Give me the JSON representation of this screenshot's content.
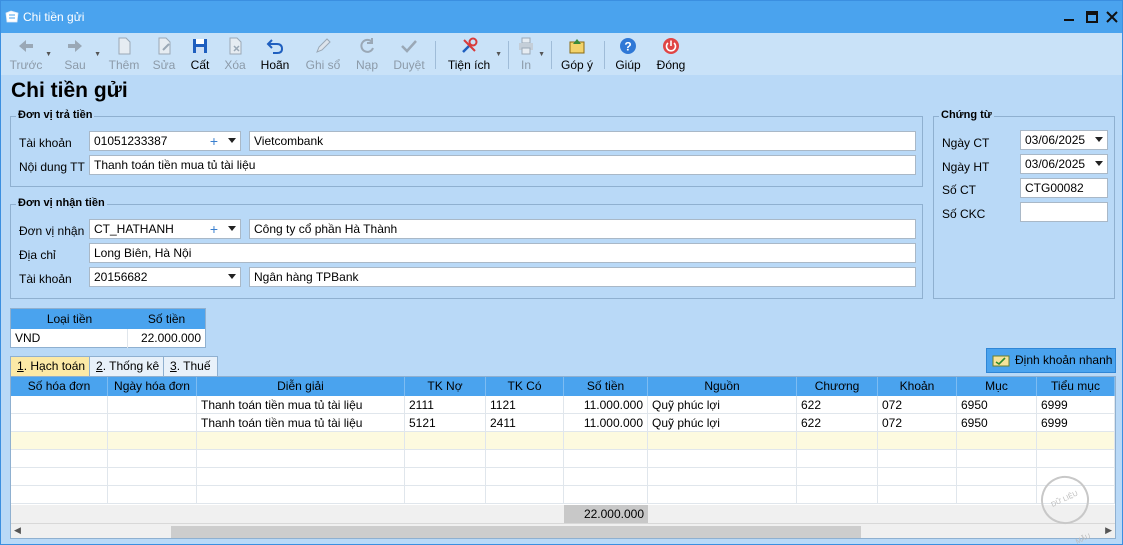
{
  "window": {
    "title": "Chi tiền gửi"
  },
  "toolbar": {
    "items": [
      {
        "label": "Trước",
        "icon": "arrow-left-icon"
      },
      {
        "label": "Sau",
        "icon": "arrow-right-icon"
      },
      {
        "label": "Thêm",
        "icon": "new-document-icon"
      },
      {
        "label": "Sửa",
        "icon": "edit-document-icon"
      },
      {
        "label": "Cất",
        "icon": "save-icon"
      },
      {
        "label": "Xóa",
        "icon": "delete-document-icon"
      },
      {
        "label": "Hoãn",
        "icon": "undo-icon"
      },
      {
        "label": "Ghi sổ",
        "icon": "pencil-icon"
      },
      {
        "label": "Nạp",
        "icon": "refresh-icon"
      },
      {
        "label": "Duyệt",
        "icon": "check-icon"
      },
      {
        "label": "Tiện ích",
        "icon": "tools-icon"
      },
      {
        "label": "In",
        "icon": "printer-icon"
      },
      {
        "label": "Góp ý",
        "icon": "feedback-icon"
      },
      {
        "label": "Giúp",
        "icon": "help-icon"
      },
      {
        "label": "Đóng",
        "icon": "power-icon"
      }
    ]
  },
  "page_title": "Chi tiền gửi",
  "payer": {
    "group_title": "Đơn vị trả tiền",
    "account_label": "Tài khoản",
    "account_value": "01051233387",
    "bank_name": "Vietcombank",
    "content_label": "Nội dung TT",
    "content_value": "Thanh toán tiền mua tủ tài liệu"
  },
  "payee": {
    "group_title": "Đơn vị nhận tiền",
    "unit_label": "Đơn vị nhận",
    "unit_code": "CT_HATHANH",
    "unit_name": "Công ty cổ phần Hà Thành",
    "address_label": "Địa chỉ",
    "address_value": "Long Biên, Hà Nội",
    "account_label": "Tài khoản",
    "account_value": "20156682",
    "bank_name": "Ngân hàng TPBank"
  },
  "voucher": {
    "group_title": "Chứng từ",
    "date_ct_label": "Ngày CT",
    "date_ct_value": "03/06/2025",
    "date_ht_label": "Ngày HT",
    "date_ht_value": "03/06/2025",
    "so_ct_label": "Số CT",
    "so_ct_value": "CTG00082",
    "so_ckc_label": "Số CKC",
    "so_ckc_value": ""
  },
  "currency": {
    "headers": [
      "Loại tiền",
      "Số tiền"
    ],
    "type": "VND",
    "amount": "22.000.000"
  },
  "tabs": [
    {
      "key": "1",
      "label": ". Hạch toán"
    },
    {
      "key": "2",
      "label": ". Thống kê"
    },
    {
      "key": "3",
      "label": ". Thuế"
    }
  ],
  "quick_button": "Định khoản nhanh",
  "grid": {
    "columns": [
      "Số hóa đơn",
      "Ngày hóa đơn",
      "Diễn giải",
      "TK Nợ",
      "TK Có",
      "Số tiền",
      "Nguồn",
      "Chương",
      "Khoản",
      "Mục",
      "Tiểu mục"
    ],
    "rows": [
      [
        "",
        "",
        "Thanh toán tiền mua tủ tài liệu",
        "2111",
        "1121",
        "11.000.000",
        "Quỹ phúc lợi",
        "622",
        "072",
        "6950",
        "6999"
      ],
      [
        "",
        "",
        "Thanh toán tiền mua tủ tài liệu",
        "5121",
        "2411",
        "11.000.000",
        "Quỹ phúc lợi",
        "622",
        "072",
        "6950",
        "6999"
      ]
    ],
    "total": "22.000.000"
  },
  "watermark": "DỮ LIỆU MẪU",
  "colors": {
    "accent": "#4aa3ee",
    "background": "#b9d9f7",
    "active_tab": "#fce9a6"
  }
}
